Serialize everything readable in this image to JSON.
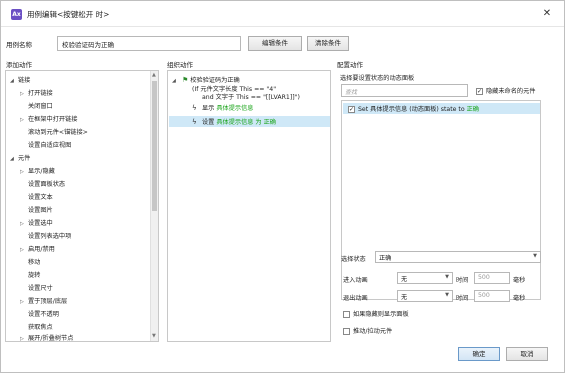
{
  "window": {
    "title": "用例编辑<按键松开 时>",
    "app_icon": "Ax",
    "close_glyph": "✕"
  },
  "case": {
    "label": "用例名称",
    "value": "校验验证码为正确",
    "edit_button": "编辑条件",
    "clear_button": "清除条件"
  },
  "sections": {
    "add_action": "添加动作",
    "organize_action": "组织动作",
    "configure_action": "配置动作"
  },
  "add_actions": [
    {
      "label": "链接",
      "level": 0,
      "arrow": "◢"
    },
    {
      "label": "打开链接",
      "level": 1,
      "arrow": "▷"
    },
    {
      "label": "关闭窗口",
      "level": 1,
      "arrow": ""
    },
    {
      "label": "在框架中打开链接",
      "level": 1,
      "arrow": "▷"
    },
    {
      "label": "滚动到元件<锚链接>",
      "level": 1,
      "arrow": ""
    },
    {
      "label": "设置自适应视图",
      "level": 1,
      "arrow": ""
    },
    {
      "label": "元件",
      "level": 0,
      "arrow": "◢"
    },
    {
      "label": "显示/隐藏",
      "level": 1,
      "arrow": "▷"
    },
    {
      "label": "设置面板状态",
      "level": 1,
      "arrow": ""
    },
    {
      "label": "设置文本",
      "level": 1,
      "arrow": ""
    },
    {
      "label": "设置图片",
      "level": 1,
      "arrow": ""
    },
    {
      "label": "设置选中",
      "level": 1,
      "arrow": "▷"
    },
    {
      "label": "设置列表选中项",
      "level": 1,
      "arrow": ""
    },
    {
      "label": "启用/禁用",
      "level": 1,
      "arrow": "▷"
    },
    {
      "label": "移动",
      "level": 1,
      "arrow": ""
    },
    {
      "label": "旋转",
      "level": 1,
      "arrow": ""
    },
    {
      "label": "设置尺寸",
      "level": 1,
      "arrow": ""
    },
    {
      "label": "置于顶层/底层",
      "level": 1,
      "arrow": "▷"
    },
    {
      "label": "设置不透明",
      "level": 1,
      "arrow": ""
    },
    {
      "label": "获取焦点",
      "level": 1,
      "arrow": ""
    },
    {
      "label": "展开/折叠树节点",
      "level": 1,
      "arrow": "▷"
    }
  ],
  "organize": {
    "case_title": "校验验证码为正确",
    "condition_line1": "(If 元件文字长度 This == \"4\"",
    "condition_line2": "and 文字于 This == \"[[LVAR1]]\")",
    "action1_verb": "显示",
    "action1_target": "具体提示信息",
    "action2_verb": "设置",
    "action2_target": "具体提示信息 为 正确"
  },
  "configure": {
    "select_panel_label": "选择要设置状态的动态面板",
    "filter_placeholder": "查找",
    "hide_unnamed_label": "隐藏未命名的元件",
    "state_item_prefix": "Set 具体提示信息 (动态面板) state to",
    "state_item_value": "正确",
    "select_state_label": "选择状态",
    "select_state_value": "正确",
    "enter_anim_label": "进入动画",
    "enter_anim_value": "无",
    "exit_anim_label": "退出动画",
    "exit_anim_value": "无",
    "time_label": "时间",
    "time_value": "500",
    "ms_label": "毫秒",
    "show_if_hidden_label": "如果隐藏则显示面板",
    "push_pull_label": "推动/拉动元件"
  },
  "buttons": {
    "ok": "确定",
    "cancel": "取消"
  },
  "colors": {
    "green_text": "#17a317",
    "selection": "#cfe8f7",
    "app_icon": "#6b4fc4"
  }
}
